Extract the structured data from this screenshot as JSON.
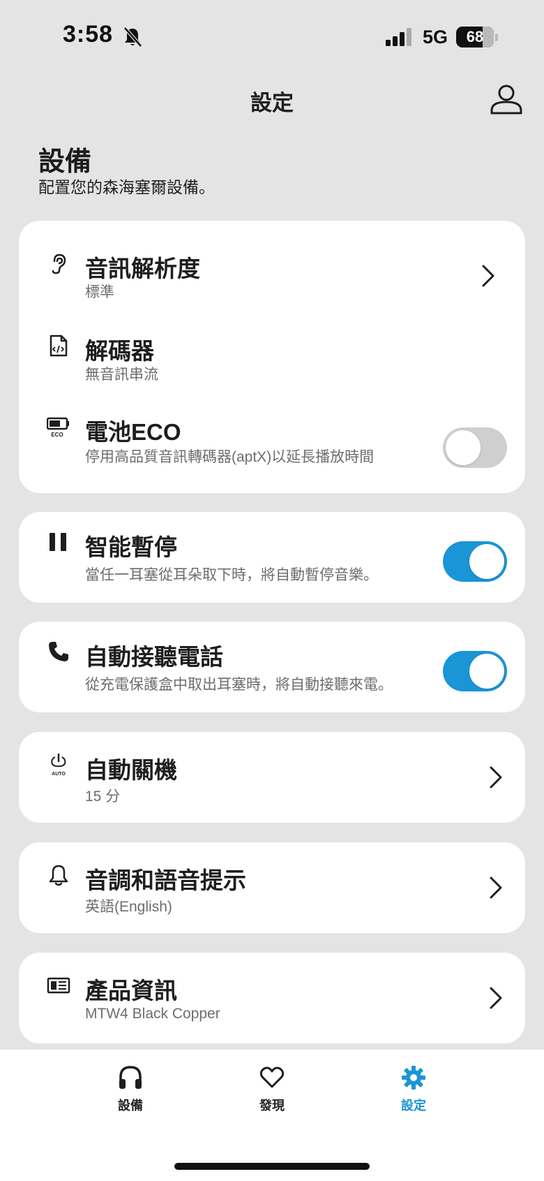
{
  "status_bar": {
    "time": "3:58",
    "network": "5G",
    "battery": "68"
  },
  "header": {
    "title": "設定"
  },
  "section": {
    "title": "設備",
    "subtitle": "配置您的森海塞爾設備。"
  },
  "settings": {
    "audio_resolution": {
      "title": "音訊解析度",
      "subtitle": "標準"
    },
    "codec": {
      "title": "解碼器",
      "subtitle": "無音訊串流"
    },
    "battery_eco": {
      "title": "電池ECO",
      "subtitle": "停用高品質音訊轉碼器(aptX)以延長播放時間",
      "icon_text": "ECO",
      "enabled": false
    },
    "smart_pause": {
      "title": "智能暫停",
      "subtitle": "當任一耳塞從耳朵取下時，將自動暫停音樂。",
      "enabled": true
    },
    "auto_answer": {
      "title": "自動接聽電話",
      "subtitle": "從充電保護盒中取出耳塞時，將自動接聽來電。",
      "enabled": true
    },
    "auto_off": {
      "title": "自動關機",
      "subtitle": "15 分",
      "icon_text": "AUTO"
    },
    "tones": {
      "title": "音調和語音提示",
      "subtitle": "英語(English)"
    },
    "product_info": {
      "title": "產品資訊",
      "subtitle": "MTW4 Black Copper"
    }
  },
  "nav": [
    {
      "label": "設備",
      "icon": "headphones-icon",
      "active": false
    },
    {
      "label": "發現",
      "icon": "heart-icon",
      "active": false
    },
    {
      "label": "設定",
      "icon": "gear-icon",
      "active": true
    }
  ],
  "colors": {
    "accent": "#1a95d6",
    "background": "#e4e4e4",
    "card": "#ffffff"
  }
}
